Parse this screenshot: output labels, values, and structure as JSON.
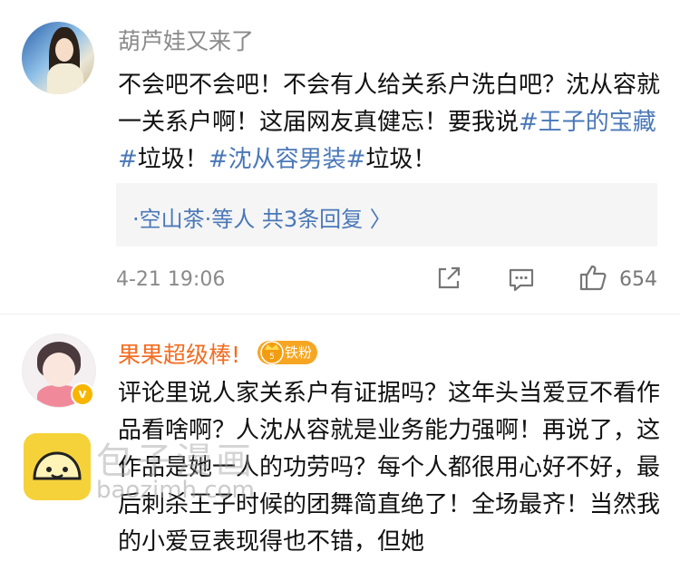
{
  "comments": [
    {
      "username": "葫芦娃又来了",
      "text_parts": [
        {
          "t": "不会吧不会吧！不会有人给关系户洗白吧？沈从容就一关系户啊！这届网友真健忘！要我说",
          "tag": false
        },
        {
          "t": "#王子的宝藏#",
          "tag": true
        },
        {
          "t": "垃圾！",
          "tag": false
        },
        {
          "t": "#沈从容男装#",
          "tag": true
        },
        {
          "t": "垃圾！",
          "tag": false
        }
      ],
      "replies_summary": "·空山茶·等人  共3条回复 〉",
      "time": "4-21 19:06",
      "likes": "654",
      "icons": [
        "share-icon",
        "comment-icon",
        "like-icon"
      ]
    },
    {
      "username": "果果超级棒!",
      "fan_badge": "铁粉",
      "verified": "v",
      "text": "评论里说人家关系户有证据吗？这年头当爱豆不看作品看啥啊？人沈从容就是业务能力强啊！再说了，这作品是她一人的功劳吗？每个人都很用心好不好，最后刺杀王子时候的团舞简直绝了！全场最齐！当然我的小爱豆表现得也不错，但她"
    }
  ],
  "watermark": {
    "text": "包子漫画",
    "url": "baozimh.com"
  },
  "colors": {
    "link": "#4a78b8",
    "username_gray": "#8a8a8a",
    "username_orange": "#f26d22",
    "fan_badge": "#f6a623"
  }
}
